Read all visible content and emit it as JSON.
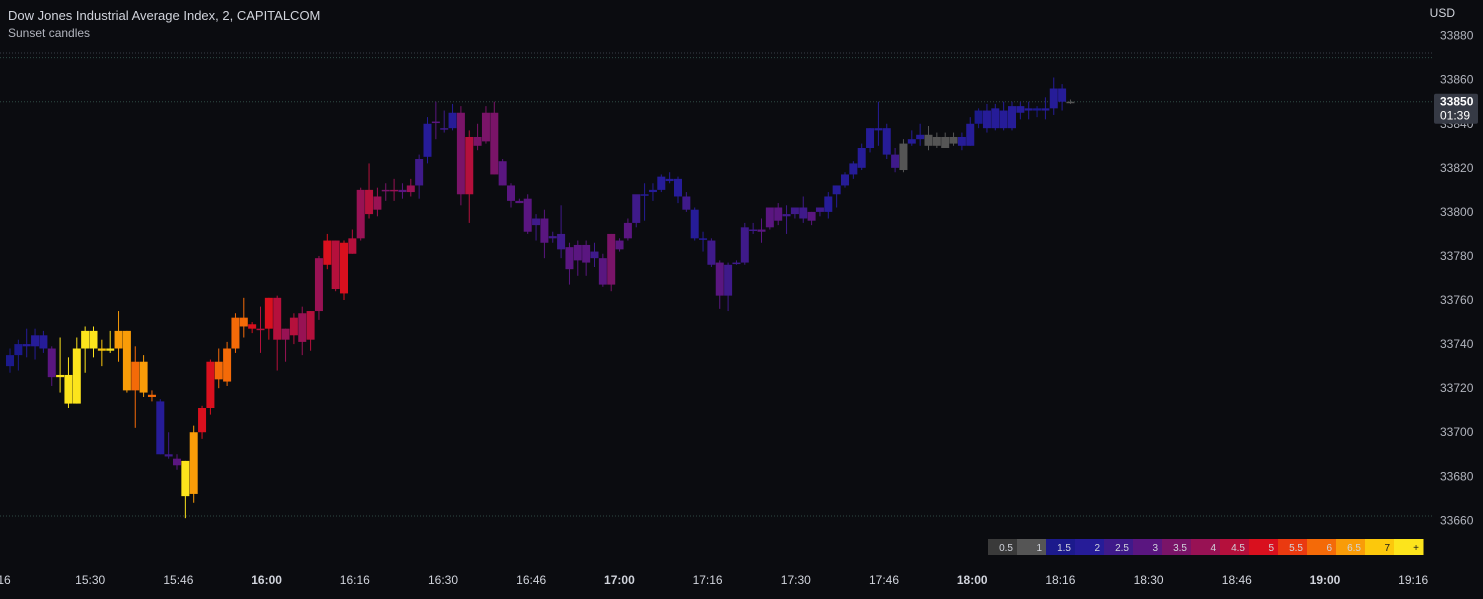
{
  "header": {
    "title": "Dow Jones Industrial Average Index, 2, CAPITALCOM",
    "indicator": "Sunset candles"
  },
  "price_axis": {
    "currency": "USD",
    "ticks": [
      "33660",
      "33680",
      "33700",
      "33720",
      "33740",
      "33760",
      "33780",
      "33800",
      "33820",
      "33840",
      "33860",
      "33880"
    ],
    "last_price": "33850",
    "countdown": "01:39"
  },
  "time_axis": {
    "ticks": [
      {
        "label": "16",
        "bold": false
      },
      {
        "label": "15:30",
        "bold": false
      },
      {
        "label": "15:46",
        "bold": false
      },
      {
        "label": "16:00",
        "bold": true
      },
      {
        "label": "16:16",
        "bold": false
      },
      {
        "label": "16:30",
        "bold": false
      },
      {
        "label": "16:46",
        "bold": false
      },
      {
        "label": "17:00",
        "bold": true
      },
      {
        "label": "17:16",
        "bold": false
      },
      {
        "label": "17:30",
        "bold": false
      },
      {
        "label": "17:46",
        "bold": false
      },
      {
        "label": "18:00",
        "bold": true
      },
      {
        "label": "18:16",
        "bold": false
      },
      {
        "label": "18:30",
        "bold": false
      },
      {
        "label": "18:46",
        "bold": false
      },
      {
        "label": "19:00",
        "bold": true
      },
      {
        "label": "19:16",
        "bold": false
      }
    ]
  },
  "legend": {
    "segments": [
      {
        "label": "0.5",
        "color": "#3a3a3a"
      },
      {
        "label": "1",
        "color": "#555555"
      },
      {
        "label": "1.5",
        "color": "#1c1a8c"
      },
      {
        "label": "2",
        "color": "#261c98"
      },
      {
        "label": "2.5",
        "color": "#3f1a8a"
      },
      {
        "label": "3",
        "color": "#5a1680"
      },
      {
        "label": "3.5",
        "color": "#7a1468"
      },
      {
        "label": "4",
        "color": "#981254"
      },
      {
        "label": "4.5",
        "color": "#b5103c"
      },
      {
        "label": "5",
        "color": "#d9101e"
      },
      {
        "label": "5.5",
        "color": "#ea3a10"
      },
      {
        "label": "6",
        "color": "#f46a08"
      },
      {
        "label": "6.5",
        "color": "#f99c08"
      },
      {
        "label": "7",
        "color": "#fcc80c"
      },
      {
        "label": "+",
        "color": "#fce41c"
      }
    ]
  },
  "chart_data": {
    "type": "candlestick",
    "x_range": [
      "15:16",
      "19:20"
    ],
    "ylim": [
      33652,
      33888
    ],
    "grid": false,
    "reference_lines": [
      33850,
      33870,
      33662
    ],
    "candles": [
      {
        "o": 33730,
        "h": 33738,
        "l": 33727,
        "c": 33735,
        "color": "#1c1a8c"
      },
      {
        "o": 33735,
        "h": 33742,
        "l": 33728,
        "c": 33740,
        "color": "#1c1a8c"
      },
      {
        "o": 33740,
        "h": 33747,
        "l": 33734,
        "c": 33739,
        "color": "#261c98"
      },
      {
        "o": 33739,
        "h": 33747,
        "l": 33733,
        "c": 33744,
        "color": "#261c98"
      },
      {
        "o": 33744,
        "h": 33746,
        "l": 33736,
        "c": 33738,
        "color": "#261c98"
      },
      {
        "o": 33738,
        "h": 33739,
        "l": 33721,
        "c": 33725,
        "color": "#5a1680"
      },
      {
        "o": 33725,
        "h": 33743,
        "l": 33718,
        "c": 33726,
        "color": "#fce41c"
      },
      {
        "o": 33726,
        "h": 33734,
        "l": 33711,
        "c": 33713,
        "color": "#fce41c"
      },
      {
        "o": 33713,
        "h": 33743,
        "l": 33713,
        "c": 33738,
        "color": "#fce41c"
      },
      {
        "o": 33738,
        "h": 33748,
        "l": 33727,
        "c": 33746,
        "color": "#fce41c"
      },
      {
        "o": 33746,
        "h": 33748,
        "l": 33734,
        "c": 33738,
        "color": "#fce41c"
      },
      {
        "o": 33738,
        "h": 33742,
        "l": 33730,
        "c": 33737,
        "color": "#fcc80c"
      },
      {
        "o": 33737,
        "h": 33746,
        "l": 33736,
        "c": 33738,
        "color": "#fce41c"
      },
      {
        "o": 33738,
        "h": 33755,
        "l": 33732,
        "c": 33746,
        "color": "#f99c08"
      },
      {
        "o": 33746,
        "h": 33746,
        "l": 33718,
        "c": 33719,
        "color": "#f99c08"
      },
      {
        "o": 33719,
        "h": 33739,
        "l": 33702,
        "c": 33732,
        "color": "#f46a08"
      },
      {
        "o": 33732,
        "h": 33735,
        "l": 33716,
        "c": 33718,
        "color": "#f99c08"
      },
      {
        "o": 33717,
        "h": 33719,
        "l": 33714,
        "c": 33716,
        "color": "#f46a08"
      },
      {
        "o": 33714,
        "h": 33715,
        "l": 33690,
        "c": 33690,
        "color": "#261c98"
      },
      {
        "o": 33690,
        "h": 33700,
        "l": 33688,
        "c": 33689,
        "color": "#3f1a8a"
      },
      {
        "o": 33688,
        "h": 33690,
        "l": 33683,
        "c": 33685,
        "color": "#5a1680"
      },
      {
        "o": 33687,
        "h": 33687,
        "l": 33661,
        "c": 33671,
        "color": "#fce41c"
      },
      {
        "o": 33672,
        "h": 33703,
        "l": 33668,
        "c": 33700,
        "color": "#f99c08"
      },
      {
        "o": 33700,
        "h": 33712,
        "l": 33697,
        "c": 33711,
        "color": "#d9101e"
      },
      {
        "o": 33711,
        "h": 33733,
        "l": 33708,
        "c": 33732,
        "color": "#d9101e"
      },
      {
        "o": 33732,
        "h": 33738,
        "l": 33720,
        "c": 33724,
        "color": "#f46a08"
      },
      {
        "o": 33723,
        "h": 33741,
        "l": 33721,
        "c": 33738,
        "color": "#f46a08"
      },
      {
        "o": 33738,
        "h": 33754,
        "l": 33736,
        "c": 33752,
        "color": "#f46a08"
      },
      {
        "o": 33752,
        "h": 33761,
        "l": 33743,
        "c": 33748,
        "color": "#f46a08"
      },
      {
        "o": 33749,
        "h": 33750,
        "l": 33745,
        "c": 33747,
        "color": "#d9101e"
      },
      {
        "o": 33747,
        "h": 33757,
        "l": 33736,
        "c": 33747,
        "color": "#b5103c"
      },
      {
        "o": 33747,
        "h": 33761,
        "l": 33742,
        "c": 33761,
        "color": "#d9101e"
      },
      {
        "o": 33761,
        "h": 33762,
        "l": 33728,
        "c": 33742,
        "color": "#b5103c"
      },
      {
        "o": 33742,
        "h": 33747,
        "l": 33732,
        "c": 33747,
        "color": "#981254"
      },
      {
        "o": 33744,
        "h": 33754,
        "l": 33740,
        "c": 33752,
        "color": "#b5103c"
      },
      {
        "o": 33754,
        "h": 33757,
        "l": 33735,
        "c": 33741,
        "color": "#981254"
      },
      {
        "o": 33742,
        "h": 33755,
        "l": 33737,
        "c": 33755,
        "color": "#b5103c"
      },
      {
        "o": 33755,
        "h": 33780,
        "l": 33751,
        "c": 33779,
        "color": "#981254"
      },
      {
        "o": 33776,
        "h": 33790,
        "l": 33774,
        "c": 33787,
        "color": "#d9101e"
      },
      {
        "o": 33787,
        "h": 33787,
        "l": 33764,
        "c": 33765,
        "color": "#b5103c"
      },
      {
        "o": 33763,
        "h": 33787,
        "l": 33760,
        "c": 33786,
        "color": "#d9101e"
      },
      {
        "o": 33781,
        "h": 33792,
        "l": 33781,
        "c": 33788,
        "color": "#b5103c"
      },
      {
        "o": 33788,
        "h": 33811,
        "l": 33787,
        "c": 33810,
        "color": "#981254"
      },
      {
        "o": 33810,
        "h": 33822,
        "l": 33797,
        "c": 33799,
        "color": "#b5103c"
      },
      {
        "o": 33801,
        "h": 33811,
        "l": 33798,
        "c": 33807,
        "color": "#981254"
      },
      {
        "o": 33810,
        "h": 33813,
        "l": 33805,
        "c": 33810,
        "color": "#7a1468"
      },
      {
        "o": 33810,
        "h": 33815,
        "l": 33805,
        "c": 33810,
        "color": "#981254"
      },
      {
        "o": 33810,
        "h": 33813,
        "l": 33806,
        "c": 33809,
        "color": "#5a1680"
      },
      {
        "o": 33809,
        "h": 33815,
        "l": 33807,
        "c": 33812,
        "color": "#981254"
      },
      {
        "o": 33812,
        "h": 33826,
        "l": 33806,
        "c": 33824,
        "color": "#3f1a8a"
      },
      {
        "o": 33825,
        "h": 33843,
        "l": 33822,
        "c": 33840,
        "color": "#261c98"
      },
      {
        "o": 33841,
        "h": 33850,
        "l": 33833,
        "c": 33841,
        "color": "#5a1680"
      },
      {
        "o": 33838,
        "h": 33846,
        "l": 33836,
        "c": 33838,
        "color": "#3f1a8a"
      },
      {
        "o": 33838,
        "h": 33849,
        "l": 33837,
        "c": 33845,
        "color": "#261c98"
      },
      {
        "o": 33845,
        "h": 33848,
        "l": 33803,
        "c": 33808,
        "color": "#7a1468"
      },
      {
        "o": 33808,
        "h": 33837,
        "l": 33795,
        "c": 33834,
        "color": "#b5103c"
      },
      {
        "o": 33834,
        "h": 33840,
        "l": 33828,
        "c": 33830,
        "color": "#7a1468"
      },
      {
        "o": 33832,
        "h": 33848,
        "l": 33831,
        "c": 33845,
        "color": "#7a1468"
      },
      {
        "o": 33845,
        "h": 33850,
        "l": 33817,
        "c": 33817,
        "color": "#7a1468"
      },
      {
        "o": 33823,
        "h": 33824,
        "l": 33812,
        "c": 33812,
        "color": "#5a1680"
      },
      {
        "o": 33812,
        "h": 33813,
        "l": 33802,
        "c": 33805,
        "color": "#5a1680"
      },
      {
        "o": 33805,
        "h": 33806,
        "l": 33804,
        "c": 33804,
        "color": "#5a1680"
      },
      {
        "o": 33806,
        "h": 33808,
        "l": 33790,
        "c": 33791,
        "color": "#5a1680"
      },
      {
        "o": 33794,
        "h": 33799,
        "l": 33787,
        "c": 33797,
        "color": "#3f1a8a"
      },
      {
        "o": 33797,
        "h": 33801,
        "l": 33779,
        "c": 33786,
        "color": "#5a1680"
      },
      {
        "o": 33788,
        "h": 33791,
        "l": 33786,
        "c": 33789,
        "color": "#3f1a8a"
      },
      {
        "o": 33790,
        "h": 33803,
        "l": 33779,
        "c": 33783,
        "color": "#3f1a8a"
      },
      {
        "o": 33784,
        "h": 33786,
        "l": 33767,
        "c": 33774,
        "color": "#5a1680"
      },
      {
        "o": 33778,
        "h": 33787,
        "l": 33771,
        "c": 33785,
        "color": "#5a1680"
      },
      {
        "o": 33785,
        "h": 33787,
        "l": 33771,
        "c": 33777,
        "color": "#5a1680"
      },
      {
        "o": 33782,
        "h": 33786,
        "l": 33775,
        "c": 33779,
        "color": "#3f1a8a"
      },
      {
        "o": 33779,
        "h": 33781,
        "l": 33766,
        "c": 33767,
        "color": "#5a1680"
      },
      {
        "o": 33767,
        "h": 33790,
        "l": 33764,
        "c": 33790,
        "color": "#7a1468"
      },
      {
        "o": 33787,
        "h": 33788,
        "l": 33782,
        "c": 33783,
        "color": "#5a1680"
      },
      {
        "o": 33788,
        "h": 33797,
        "l": 33787,
        "c": 33795,
        "color": "#5a1680"
      },
      {
        "o": 33795,
        "h": 33807,
        "l": 33793,
        "c": 33808,
        "color": "#3f1a8a"
      },
      {
        "o": 33808,
        "h": 33813,
        "l": 33796,
        "c": 33808,
        "color": "#261c98"
      },
      {
        "o": 33809,
        "h": 33813,
        "l": 33805,
        "c": 33810,
        "color": "#261c98"
      },
      {
        "o": 33810,
        "h": 33817,
        "l": 33809,
        "c": 33816,
        "color": "#261c98"
      },
      {
        "o": 33815,
        "h": 33818,
        "l": 33813,
        "c": 33814,
        "color": "#261c98"
      },
      {
        "o": 33815,
        "h": 33816,
        "l": 33804,
        "c": 33807,
        "color": "#261c98"
      },
      {
        "o": 33807,
        "h": 33809,
        "l": 33800,
        "c": 33801,
        "color": "#3f1a8a"
      },
      {
        "o": 33801,
        "h": 33802,
        "l": 33787,
        "c": 33788,
        "color": "#261c98"
      },
      {
        "o": 33788,
        "h": 33791,
        "l": 33782,
        "c": 33788,
        "color": "#261c98"
      },
      {
        "o": 33787,
        "h": 33788,
        "l": 33775,
        "c": 33776,
        "color": "#3f1a8a"
      },
      {
        "o": 33777,
        "h": 33778,
        "l": 33756,
        "c": 33762,
        "color": "#5a1680"
      },
      {
        "o": 33762,
        "h": 33777,
        "l": 33755,
        "c": 33776,
        "color": "#3f1a8a"
      },
      {
        "o": 33777,
        "h": 33778,
        "l": 33776,
        "c": 33777,
        "color": "#3f1a8a"
      },
      {
        "o": 33777,
        "h": 33795,
        "l": 33776,
        "c": 33793,
        "color": "#3f1a8a"
      },
      {
        "o": 33792,
        "h": 33795,
        "l": 33790,
        "c": 33792,
        "color": "#3f1a8a"
      },
      {
        "o": 33791,
        "h": 33797,
        "l": 33786,
        "c": 33792,
        "color": "#5a1680"
      },
      {
        "o": 33793,
        "h": 33802,
        "l": 33792,
        "c": 33802,
        "color": "#5a1680"
      },
      {
        "o": 33802,
        "h": 33804,
        "l": 33794,
        "c": 33796,
        "color": "#5a1680"
      },
      {
        "o": 33798,
        "h": 33803,
        "l": 33790,
        "c": 33799,
        "color": "#3f1a8a"
      },
      {
        "o": 33799,
        "h": 33802,
        "l": 33797,
        "c": 33802,
        "color": "#3f1a8a"
      },
      {
        "o": 33802,
        "h": 33807,
        "l": 33795,
        "c": 33797,
        "color": "#3f1a8a"
      },
      {
        "o": 33796,
        "h": 33800,
        "l": 33794,
        "c": 33800,
        "color": "#5a1680"
      },
      {
        "o": 33800,
        "h": 33802,
        "l": 33798,
        "c": 33802,
        "color": "#3f1a8a"
      },
      {
        "o": 33800,
        "h": 33809,
        "l": 33797,
        "c": 33807,
        "color": "#261c98"
      },
      {
        "o": 33808,
        "h": 33812,
        "l": 33802,
        "c": 33812,
        "color": "#261c98"
      },
      {
        "o": 33812,
        "h": 33818,
        "l": 33811,
        "c": 33817,
        "color": "#261c98"
      },
      {
        "o": 33817,
        "h": 33823,
        "l": 33815,
        "c": 33822,
        "color": "#261c98"
      },
      {
        "o": 33820,
        "h": 33831,
        "l": 33819,
        "c": 33829,
        "color": "#261c98"
      },
      {
        "o": 33829,
        "h": 33838,
        "l": 33827,
        "c": 33838,
        "color": "#261c98"
      },
      {
        "o": 33837,
        "h": 33850,
        "l": 33830,
        "c": 33838,
        "color": "#261c98"
      },
      {
        "o": 33838,
        "h": 33840,
        "l": 33824,
        "c": 33826,
        "color": "#261c98"
      },
      {
        "o": 33826,
        "h": 33829,
        "l": 33818,
        "c": 33820,
        "color": "#3f1a8a"
      },
      {
        "o": 33819,
        "h": 33833,
        "l": 33818,
        "c": 33831,
        "color": "#555555"
      },
      {
        "o": 33831,
        "h": 33837,
        "l": 33830,
        "c": 33833,
        "color": "#261c98"
      },
      {
        "o": 33833,
        "h": 33840,
        "l": 33830,
        "c": 33835,
        "color": "#261c98"
      },
      {
        "o": 33835,
        "h": 33839,
        "l": 33828,
        "c": 33830,
        "color": "#555555"
      },
      {
        "o": 33830,
        "h": 33836,
        "l": 33829,
        "c": 33834,
        "color": "#555555"
      },
      {
        "o": 33834,
        "h": 33836,
        "l": 33829,
        "c": 33829,
        "color": "#555555"
      },
      {
        "o": 33831,
        "h": 33836,
        "l": 33830,
        "c": 33834,
        "color": "#555555"
      },
      {
        "o": 33834,
        "h": 33836,
        "l": 33828,
        "c": 33830,
        "color": "#261c98"
      },
      {
        "o": 33830,
        "h": 33843,
        "l": 33830,
        "c": 33840,
        "color": "#261c98"
      },
      {
        "o": 33840,
        "h": 33847,
        "l": 33838,
        "c": 33846,
        "color": "#1c1a8c"
      },
      {
        "o": 33846,
        "h": 33849,
        "l": 33836,
        "c": 33838,
        "color": "#261c98"
      },
      {
        "o": 33838,
        "h": 33849,
        "l": 33837,
        "c": 33847,
        "color": "#261c98"
      },
      {
        "o": 33846,
        "h": 33850,
        "l": 33837,
        "c": 33838,
        "color": "#261c98"
      },
      {
        "o": 33838,
        "h": 33850,
        "l": 33837,
        "c": 33848,
        "color": "#261c98"
      },
      {
        "o": 33848,
        "h": 33850,
        "l": 33842,
        "c": 33845,
        "color": "#261c98"
      },
      {
        "o": 33846,
        "h": 33850,
        "l": 33842,
        "c": 33847,
        "color": "#261c98"
      },
      {
        "o": 33847,
        "h": 33848,
        "l": 33843,
        "c": 33846,
        "color": "#1c1a8c"
      },
      {
        "o": 33846,
        "h": 33852,
        "l": 33842,
        "c": 33847,
        "color": "#261c98"
      },
      {
        "o": 33847,
        "h": 33861,
        "l": 33844,
        "c": 33856,
        "color": "#261c98"
      },
      {
        "o": 33856,
        "h": 33858,
        "l": 33846,
        "c": 33850,
        "color": "#261c98"
      },
      {
        "o": 33850,
        "h": 33851,
        "l": 33849,
        "c": 33850,
        "color": "#555555"
      }
    ]
  }
}
